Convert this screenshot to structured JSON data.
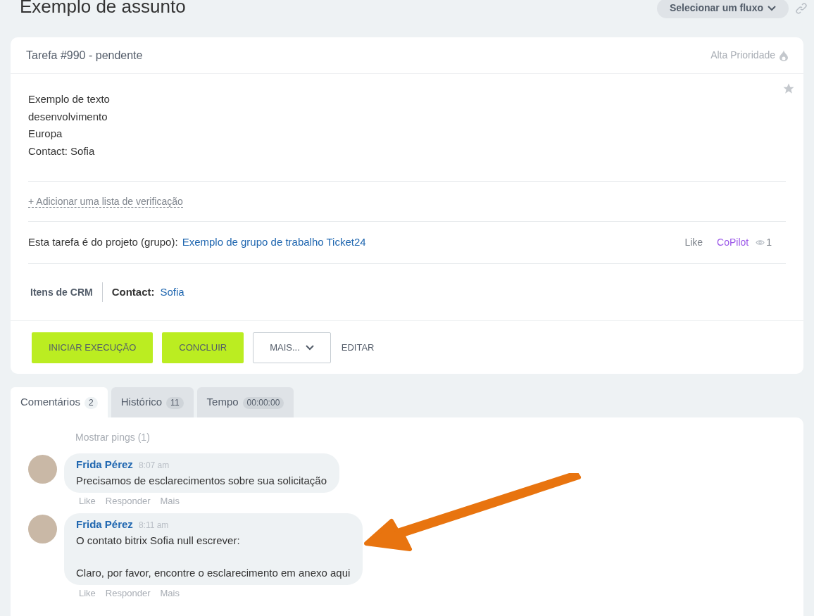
{
  "title": "Exemplo de assunto",
  "flow_button": "Selecionar um fluxo",
  "task": {
    "header": "Tarefa #990 - pendente",
    "priority": "Alta Prioridade",
    "description": [
      "Exemplo de texto",
      "desenvolvimento",
      "Europa",
      "Contact: Sofia"
    ],
    "checklist_link": "+ Adicionar uma lista de verificação",
    "project_label": "Esta tarefa é do projeto (grupo):",
    "project_link": "Exemplo de grupo de trabalho Ticket24",
    "like": "Like",
    "copilot": "CoPilot",
    "views": "1",
    "crm_label": "Itens de CRM",
    "contact_label": "Contact:",
    "contact_value": "Sofia",
    "buttons": [
      {
        "kind": "primary",
        "label": "INICIAR EXECUÇÃO"
      },
      {
        "kind": "primary",
        "label": "CONCLUIR"
      },
      {
        "kind": "dropdown",
        "label": "MAIS..."
      },
      {
        "kind": "link",
        "label": "EDITAR"
      }
    ]
  },
  "tabs": [
    {
      "label": "Comentários",
      "count": "2",
      "selected": true
    },
    {
      "label": "Histórico",
      "count": "11",
      "selected": false
    },
    {
      "label": "Tempo",
      "count": "00:00:00",
      "selected": false
    }
  ],
  "show_pings": "Mostrar pings (1)",
  "comments": [
    {
      "author": "Frida Pérez",
      "time": "8:07 am",
      "paragraphs": [
        "Precisamos de esclarecimentos sobre sua solicitação"
      ],
      "actions": [
        "Like",
        "Responder",
        "Mais"
      ]
    },
    {
      "author": "Frida Pérez",
      "time": "8:11 am",
      "paragraphs": [
        "O contato bitrix Sofia null escrever:",
        "Claro, por favor, encontre o esclarecimento em anexo aqui"
      ],
      "actions": [
        "Like",
        "Responder",
        "Mais"
      ]
    }
  ]
}
